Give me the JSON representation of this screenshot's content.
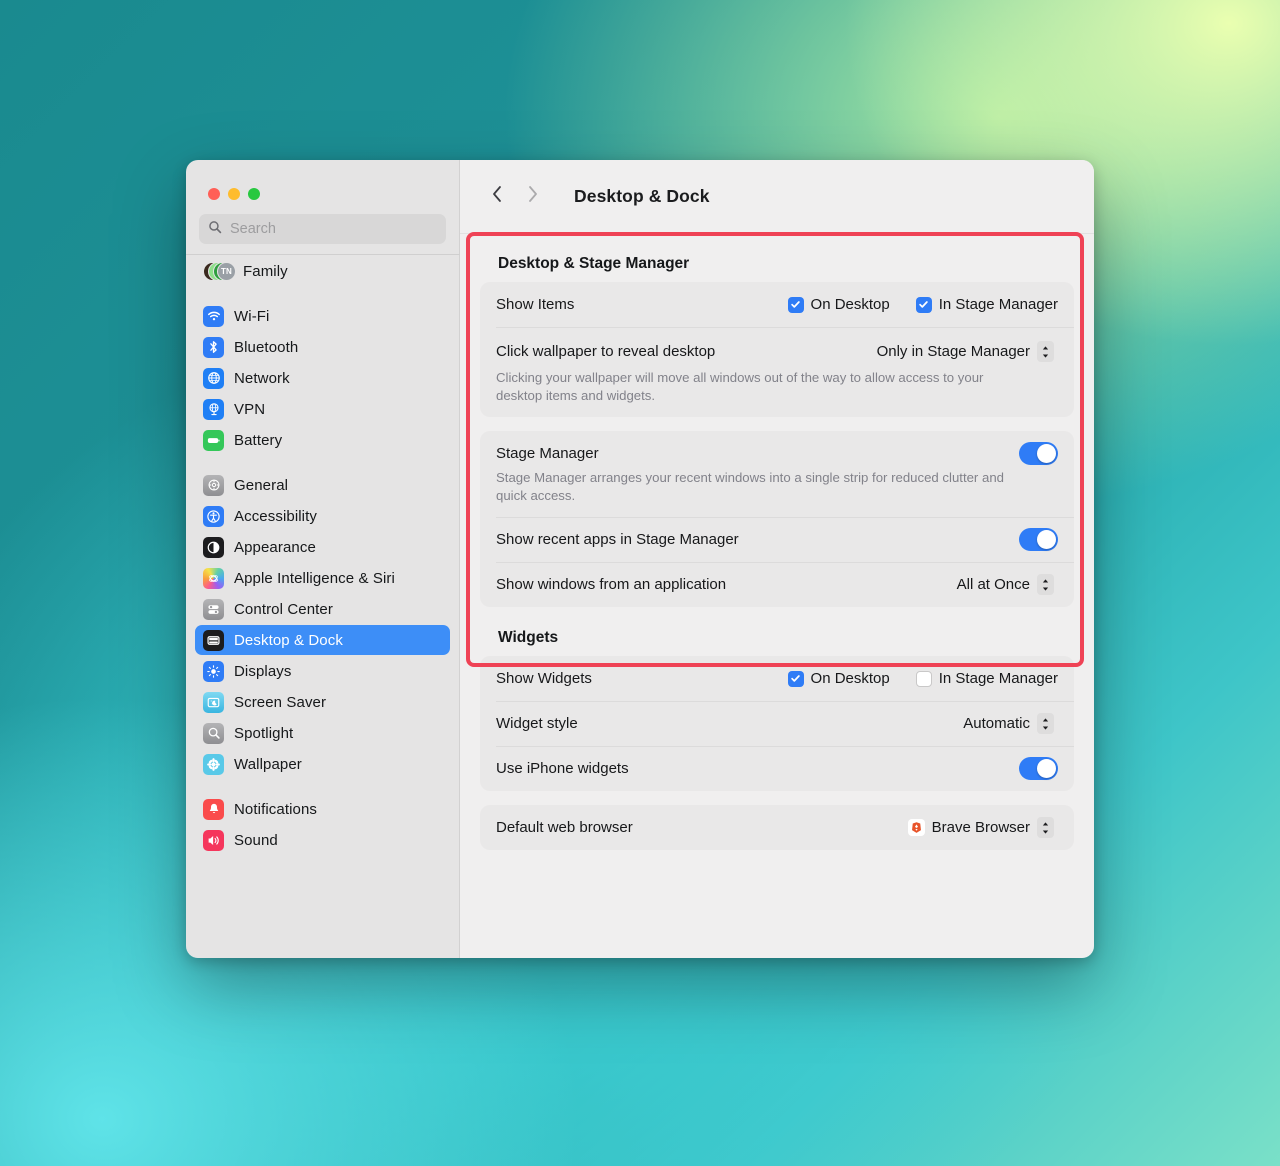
{
  "window": {
    "traffic_lights": [
      "close",
      "minimize",
      "zoom"
    ],
    "title": "Desktop & Dock"
  },
  "search": {
    "placeholder": "Search",
    "value": "",
    "icon": "search-icon"
  },
  "sidebar": {
    "groups": [
      {
        "items": [
          {
            "label": "Family",
            "icon": "family-avatars",
            "initials": "TN",
            "selected": false
          }
        ]
      },
      {
        "items": [
          {
            "label": "Wi-Fi",
            "icon": "wifi-icon",
            "selected": false
          },
          {
            "label": "Bluetooth",
            "icon": "bluetooth-icon",
            "selected": false
          },
          {
            "label": "Network",
            "icon": "network-globe-icon",
            "selected": false
          },
          {
            "label": "VPN",
            "icon": "vpn-icon",
            "selected": false
          },
          {
            "label": "Battery",
            "icon": "battery-icon",
            "selected": false
          }
        ]
      },
      {
        "items": [
          {
            "label": "General",
            "icon": "gear-icon",
            "selected": false
          },
          {
            "label": "Accessibility",
            "icon": "accessibility-icon",
            "selected": false
          },
          {
            "label": "Appearance",
            "icon": "appearance-icon",
            "selected": false
          },
          {
            "label": "Apple Intelligence & Siri",
            "icon": "siri-icon",
            "selected": false
          },
          {
            "label": "Control Center",
            "icon": "control-center-icon",
            "selected": false
          },
          {
            "label": "Desktop & Dock",
            "icon": "desktop-dock-icon",
            "selected": true
          },
          {
            "label": "Displays",
            "icon": "displays-icon",
            "selected": false
          },
          {
            "label": "Screen Saver",
            "icon": "screen-saver-icon",
            "selected": false
          },
          {
            "label": "Spotlight",
            "icon": "spotlight-icon",
            "selected": false
          },
          {
            "label": "Wallpaper",
            "icon": "wallpaper-icon",
            "selected": false
          }
        ]
      },
      {
        "items": [
          {
            "label": "Notifications",
            "icon": "notifications-icon",
            "selected": false
          },
          {
            "label": "Sound",
            "icon": "sound-icon",
            "selected": false
          }
        ]
      }
    ]
  },
  "toolbar": {
    "back_icon": "chevron-left-icon",
    "forward_icon": "chevron-right-icon",
    "title": "Desktop & Dock"
  },
  "main": {
    "sections": [
      {
        "title": "Desktop & Stage Manager",
        "rows": [
          {
            "label": "Show Items",
            "control": "checkboxes",
            "checkboxes": [
              {
                "label": "On Desktop",
                "checked": true
              },
              {
                "label": "In Stage Manager",
                "checked": true
              }
            ]
          },
          {
            "label": "Click wallpaper to reveal desktop",
            "description": "Clicking your wallpaper will move all windows out of the way to allow access to your desktop items and widgets.",
            "control": "popup",
            "value": "Only in Stage Manager"
          }
        ]
      },
      {
        "title": "",
        "rows": [
          {
            "label": "Stage Manager",
            "description": "Stage Manager arranges your recent windows into a single strip for reduced clutter and quick access.",
            "control": "toggle",
            "value": "on"
          },
          {
            "label": "Show recent apps in Stage Manager",
            "control": "toggle",
            "value": "on"
          },
          {
            "label": "Show windows from an application",
            "control": "popup",
            "value": "All at Once"
          }
        ]
      },
      {
        "title": "Widgets",
        "rows": [
          {
            "label": "Show Widgets",
            "control": "checkboxes",
            "checkboxes": [
              {
                "label": "On Desktop",
                "checked": true
              },
              {
                "label": "In Stage Manager",
                "checked": false
              }
            ]
          },
          {
            "label": "Widget style",
            "control": "popup",
            "value": "Automatic"
          },
          {
            "label": "Use iPhone widgets",
            "control": "toggle",
            "value": "on"
          }
        ]
      },
      {
        "title": "",
        "rows": [
          {
            "label": "Default web browser",
            "control": "popup-with-icon",
            "icon": "brave-browser-icon",
            "value": "Brave Browser"
          }
        ]
      }
    ]
  },
  "annotation": {
    "type": "highlight-rectangle",
    "color": "#ef4255",
    "target": "Desktop & Stage Manager settings group"
  },
  "colors": {
    "accent": "#2f7cf6",
    "selection": "#3d8ef7",
    "annotation": "#ef4255",
    "window_bg": "#f0efef",
    "sidebar_bg": "#e5e4e4",
    "card_bg": "#e9e8e8"
  }
}
